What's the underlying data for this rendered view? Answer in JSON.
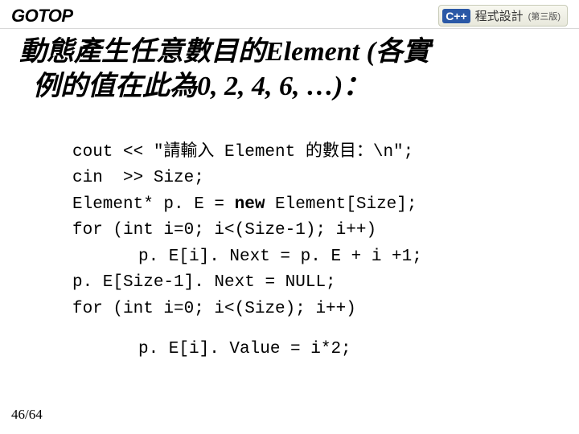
{
  "header": {
    "logo": "GOTOP",
    "badge_lang": "C++",
    "badge_text": "程式設計",
    "badge_edition": "(第三版)"
  },
  "title": {
    "line1_pre": "動態產生任意數目的",
    "line1_latin": "Element (",
    "line1_post": "各實",
    "line2_pre": "例的值在此為",
    "line2_latin": "0, 2, 4, 6, …)",
    "line2_post": "："
  },
  "code": {
    "l1": "cout << \"請輸入 Element 的數目：\\n\";",
    "l2": "cin  >> Size;",
    "l3a": "Element* p. E = ",
    "l3kw": "new",
    "l3b": " Element[Size];",
    "l4": "for (int i=0; i<(Size-1); i++)",
    "l5": "p. E[i]. Next = p. E + i +1;",
    "l6": "p. E[Size-1]. Next = NULL;",
    "l7": "for (int i=0; i<(Size); i++)",
    "l8": "p. E[i]. Value = i*2;"
  },
  "pagenum": "46/64"
}
